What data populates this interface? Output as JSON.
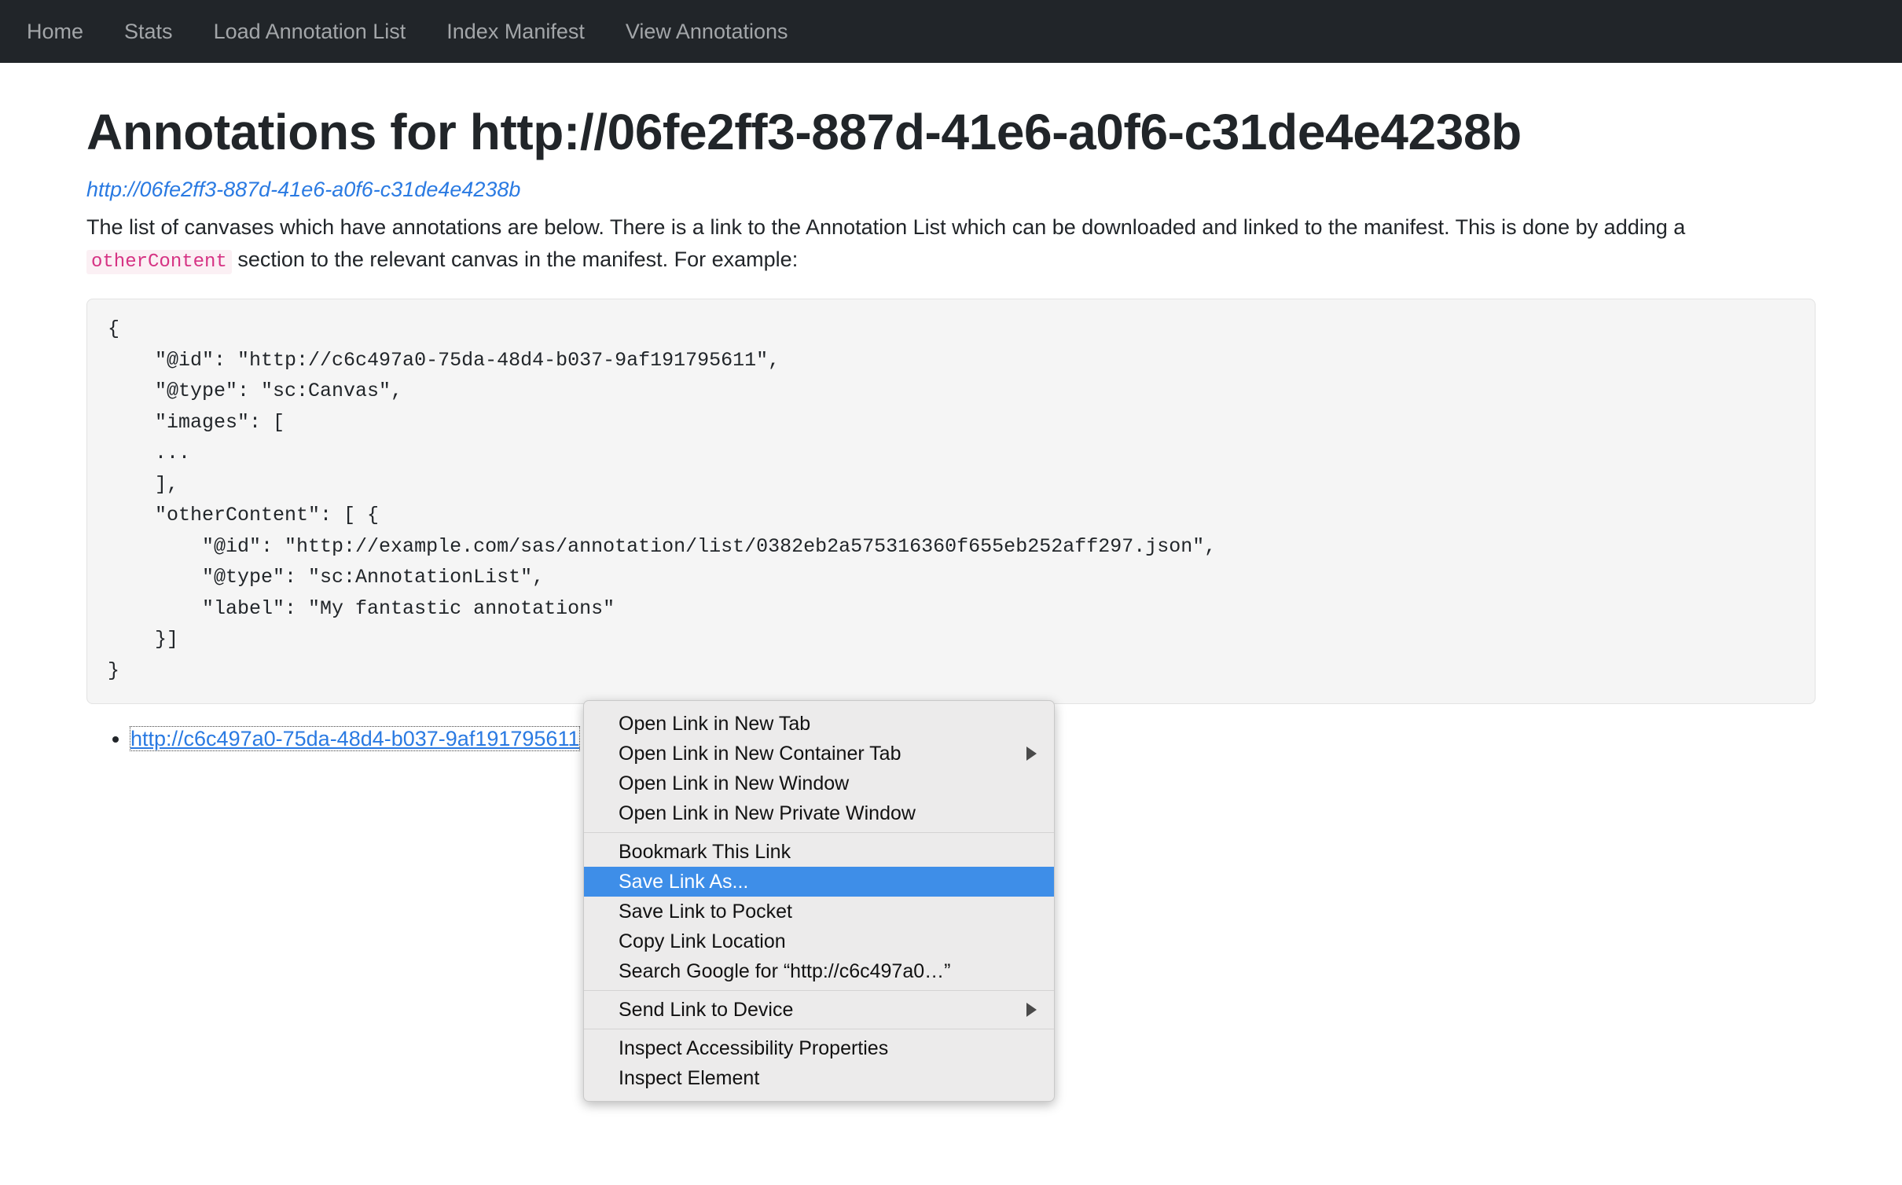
{
  "navbar": {
    "items": [
      {
        "label": "Home"
      },
      {
        "label": "Stats"
      },
      {
        "label": "Load Annotation List"
      },
      {
        "label": "Index Manifest"
      },
      {
        "label": "View Annotations"
      }
    ]
  },
  "page": {
    "title": "Annotations for http://06fe2ff3-887d-41e6-a0f6-c31de4e4238b",
    "manifest_link": "http://06fe2ff3-887d-41e6-a0f6-c31de4e4238b",
    "intro_part1": "The list of canvases which have annotations are below. There is a link to the Annotation List which can be downloaded and linked to the manifest. This is done by adding a ",
    "intro_code": "otherContent",
    "intro_part2": " section to the relevant canvas in the manifest. For example:",
    "code_sample": "{\n    \"@id\": \"http://c6c497a0-75da-48d4-b037-9af191795611\",\n    \"@type\": \"sc:Canvas\",\n    \"images\": [\n    ...\n    ],\n    \"otherContent\": [ {\n        \"@id\": \"http://example.com/sas/annotation/list/0382eb2a575316360f655eb252aff297.json\",\n        \"@type\": \"sc:AnnotationList\",\n        \"label\": \"My fantastic annotations\"\n    }]\n}",
    "canvas_items": [
      {
        "label": "http://c6c497a0-75da-48d4-b037-9af191795611"
      }
    ]
  },
  "context_menu": {
    "groups": [
      {
        "items": [
          {
            "label": "Open Link in New Tab",
            "submenu": false,
            "highlight": false
          },
          {
            "label": "Open Link in New Container Tab",
            "submenu": true,
            "highlight": false
          },
          {
            "label": "Open Link in New Window",
            "submenu": false,
            "highlight": false
          },
          {
            "label": "Open Link in New Private Window",
            "submenu": false,
            "highlight": false
          }
        ]
      },
      {
        "items": [
          {
            "label": "Bookmark This Link",
            "submenu": false,
            "highlight": false
          },
          {
            "label": "Save Link As...",
            "submenu": false,
            "highlight": true
          },
          {
            "label": "Save Link to Pocket",
            "submenu": false,
            "highlight": false
          },
          {
            "label": "Copy Link Location",
            "submenu": false,
            "highlight": false
          },
          {
            "label": "Search Google for “http://c6c497a0…”",
            "submenu": false,
            "highlight": false
          }
        ]
      },
      {
        "items": [
          {
            "label": "Send Link to Device",
            "submenu": true,
            "highlight": false
          }
        ]
      },
      {
        "items": [
          {
            "label": "Inspect Accessibility Properties",
            "submenu": false,
            "highlight": false
          },
          {
            "label": "Inspect Element",
            "submenu": false,
            "highlight": false
          }
        ]
      }
    ],
    "highlight_color": "#3e8ee8",
    "background_color": "#ecebeb"
  }
}
